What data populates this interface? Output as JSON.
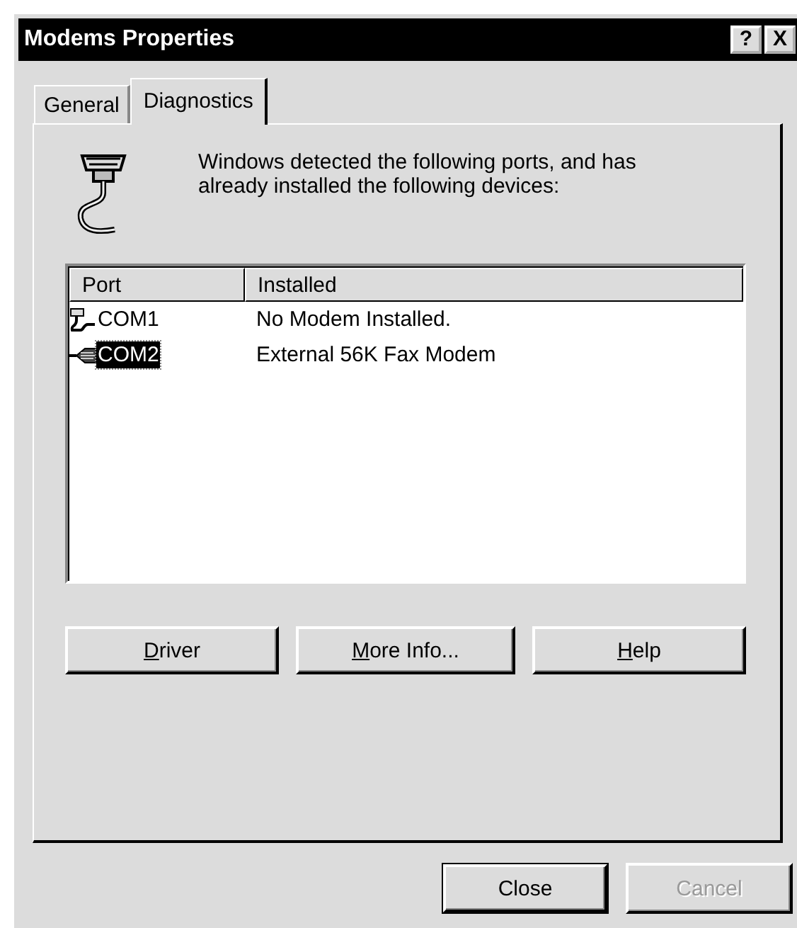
{
  "window": {
    "title": "Modems Properties",
    "title_buttons": [
      "?",
      "X"
    ]
  },
  "tabs": [
    {
      "label": "General",
      "selected": false
    },
    {
      "label": "Diagnostics",
      "selected": true
    }
  ],
  "description": "Windows detected the following ports, and has already installed the following devices:",
  "table": {
    "columns": [
      "Port",
      "Installed"
    ],
    "rows": [
      {
        "port": "COM1",
        "installed": "No Modem Installed.",
        "kind": "empty",
        "selected": false
      },
      {
        "port": "COM2",
        "installed": "External 56K Fax Modem",
        "kind": "modem",
        "selected": true
      }
    ]
  },
  "panel_buttons": [
    {
      "label_parts": [
        {
          "text": "D",
          "underline": true
        },
        {
          "text": "river",
          "underline": false
        }
      ]
    },
    {
      "label_parts": [
        {
          "text": "M",
          "underline": true
        },
        {
          "text": "ore Info...",
          "underline": false
        }
      ]
    },
    {
      "label_parts": [
        {
          "text": "H",
          "underline": true
        },
        {
          "text": "elp",
          "underline": false
        }
      ]
    }
  ],
  "footer_buttons": [
    {
      "label": "Close",
      "default": true,
      "disabled": false
    },
    {
      "label": "Cancel",
      "default": false,
      "disabled": true
    }
  ]
}
